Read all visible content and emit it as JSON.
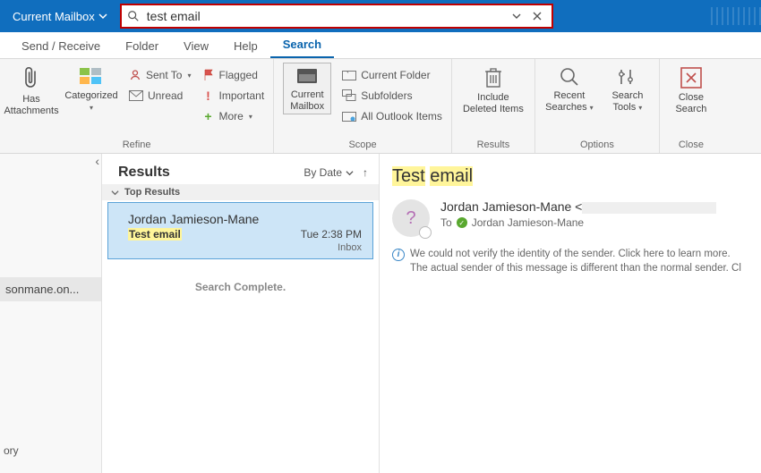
{
  "search": {
    "scope_label": "Current Mailbox",
    "query": "test email"
  },
  "menu": {
    "tabs": [
      "Send / Receive",
      "Folder",
      "View",
      "Help",
      "Search"
    ],
    "active_index": 4
  },
  "ribbon": {
    "refine": {
      "has_attachments": "Has\nAttachments",
      "categorized": "Categorized",
      "sent_to": "Sent To",
      "unread": "Unread",
      "flagged": "Flagged",
      "important": "Important",
      "more": "More",
      "label": "Refine"
    },
    "scope": {
      "current_mailbox": "Current\nMailbox",
      "current_folder": "Current Folder",
      "subfolders": "Subfolders",
      "all_outlook": "All Outlook Items",
      "label": "Scope"
    },
    "results_grp": {
      "include_deleted": "Include\nDeleted Items",
      "label": "Results"
    },
    "options": {
      "recent_searches": "Recent\nSearches",
      "search_tools": "Search\nTools",
      "label": "Options"
    },
    "close": {
      "close_search": "Close\nSearch",
      "label": "Close"
    }
  },
  "left_rail": {
    "account_fragment": "sonmane.on...",
    "history_fragment": "ory"
  },
  "results": {
    "heading": "Results",
    "sort_label": "By Date",
    "top_results_label": "Top Results",
    "items": [
      {
        "from": "Jordan Jamieson-Mane",
        "subject": "Test email",
        "time": "Tue 2:38 PM",
        "folder": "Inbox"
      }
    ],
    "complete_text": "Search Complete."
  },
  "reading": {
    "subject_parts": [
      "Test",
      "email"
    ],
    "sender_name": "Jordan Jamieson-Mane",
    "to_label": "To",
    "to_name": "Jordan Jamieson-Mane",
    "warning_line1": "We could not verify the identity of the sender. Click here to learn more.",
    "warning_line2": "The actual sender of this message is different than the normal sender. Cl"
  }
}
